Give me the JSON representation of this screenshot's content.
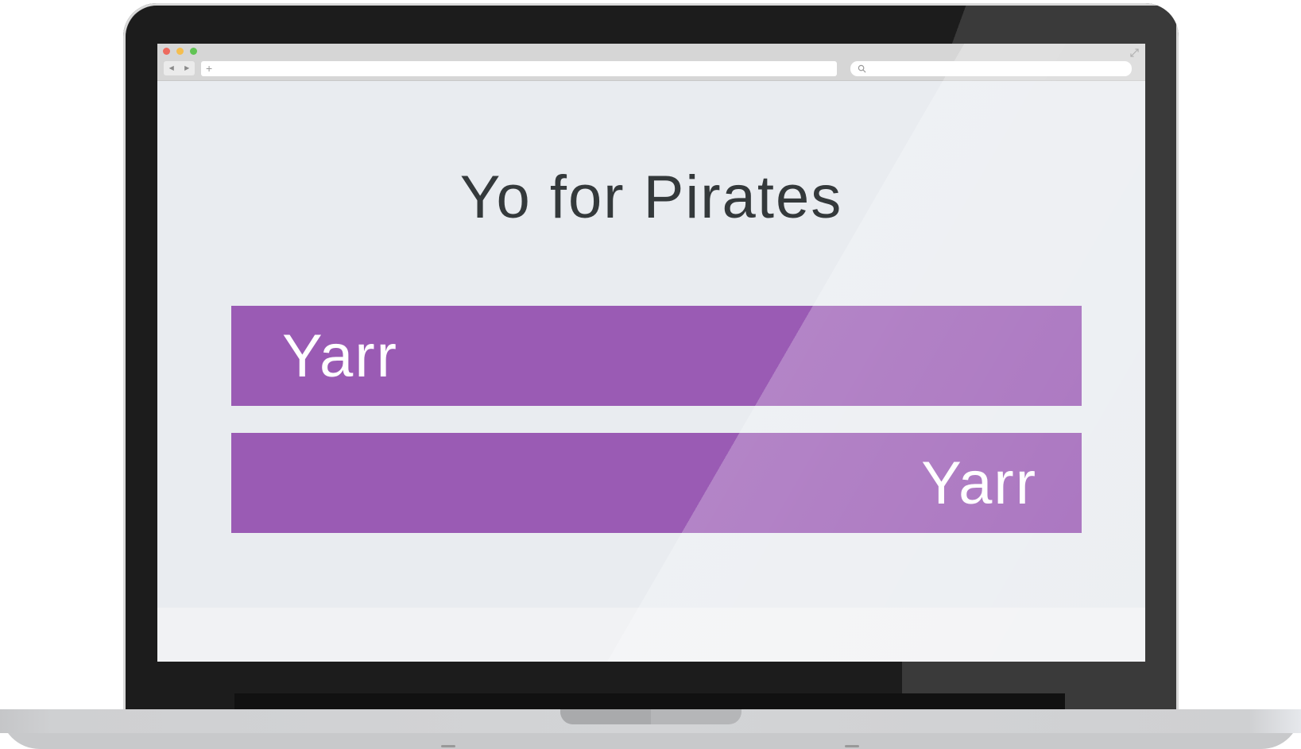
{
  "browser": {
    "url_value": "",
    "search_value": "",
    "traffic_lights": {
      "close": "#ed6a5e",
      "minimize": "#f5be4f",
      "zoom": "#61c454"
    },
    "icons": [
      "back-arrow-icon",
      "forward-arrow-icon",
      "plus-icon",
      "search-icon",
      "expand-icon"
    ],
    "nav_back": "◀",
    "nav_forward": "▶",
    "new_tab": "+"
  },
  "page": {
    "title": "Yo for Pirates",
    "bars": [
      {
        "label": "Yarr",
        "align": "left"
      },
      {
        "label": "Yarr",
        "align": "right"
      }
    ],
    "colors": {
      "bar": "#9a5bb4",
      "background": "#e9ecf0",
      "title_text": "#34393b"
    }
  }
}
